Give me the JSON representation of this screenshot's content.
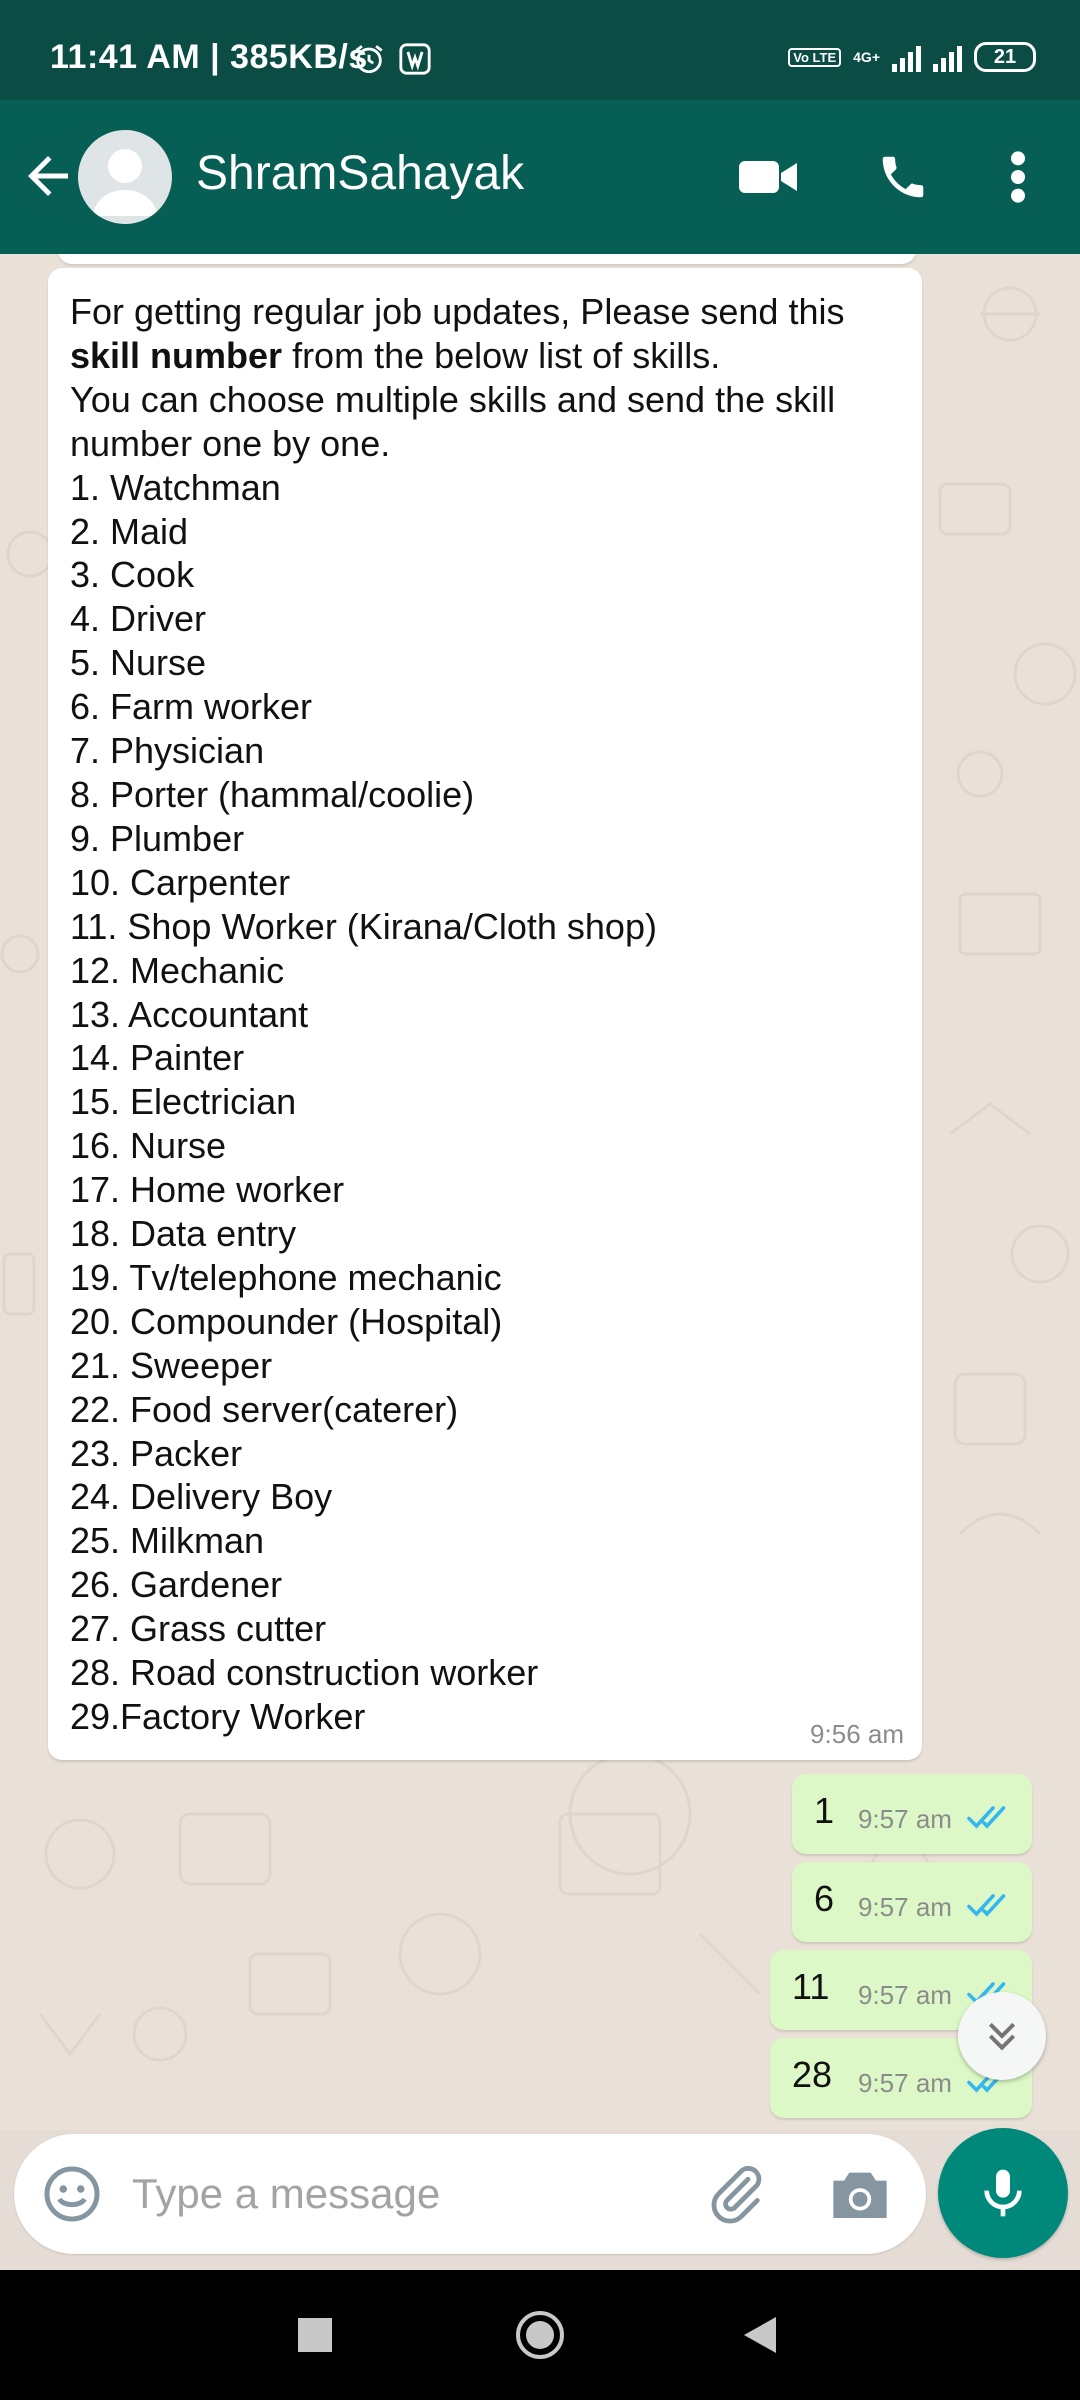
{
  "status_bar": {
    "time": "11:41 AM | 385KB/s",
    "network": "4G+",
    "volte": "Vo LTE",
    "battery": "21"
  },
  "header": {
    "contact_name": "ShramSahayak",
    "icons": [
      "back-arrow-icon",
      "avatar",
      "video-call-icon",
      "phone-call-icon",
      "more-vert-icon"
    ]
  },
  "chat": {
    "incoming": {
      "intro_before_bold": "For getting regular job updates, Please send this",
      "bold": "skill number",
      "intro_after_bold": " from the below list of skills.",
      "line2": "You can choose multiple skills and send the skill number one by one.",
      "skills": [
        "1. Watchman",
        "2. Maid",
        "3. Cook",
        "4. Driver",
        "5. Nurse",
        "6. Farm worker",
        "7. Physician",
        "8. Porter (hammal/coolie)",
        "9. Plumber",
        "10. Carpenter",
        "11. Shop Worker (Kirana/Cloth shop)",
        "12. Mechanic",
        "13. Accountant",
        "14. Painter",
        "15. Electrician",
        "16. Nurse",
        "17. Home worker",
        "18. Data entry",
        "19. Tv/telephone mechanic",
        "20. Compounder (Hospital)",
        "21. Sweeper",
        "22. Food server(caterer)",
        "23. Packer",
        "24. Delivery Boy",
        "25. Milkman",
        "26. Gardener",
        "27. Grass cutter",
        "28. Road construction worker",
        "29.Factory Worker"
      ],
      "time": "9:56 am"
    },
    "outgoing": [
      {
        "text": "1",
        "time": "9:57 am"
      },
      {
        "text": "6",
        "time": "9:57 am"
      },
      {
        "text": "11",
        "time": "9:57 am"
      },
      {
        "text": "28",
        "time": "9:57 am"
      }
    ]
  },
  "input": {
    "placeholder": "Type a message"
  },
  "colors": {
    "header": "#075e54",
    "status_bar": "#0b4d45",
    "outgoing_bubble": "#dcf8c6",
    "tick_blue": "#34b7f1",
    "mic_button": "#00897b"
  }
}
